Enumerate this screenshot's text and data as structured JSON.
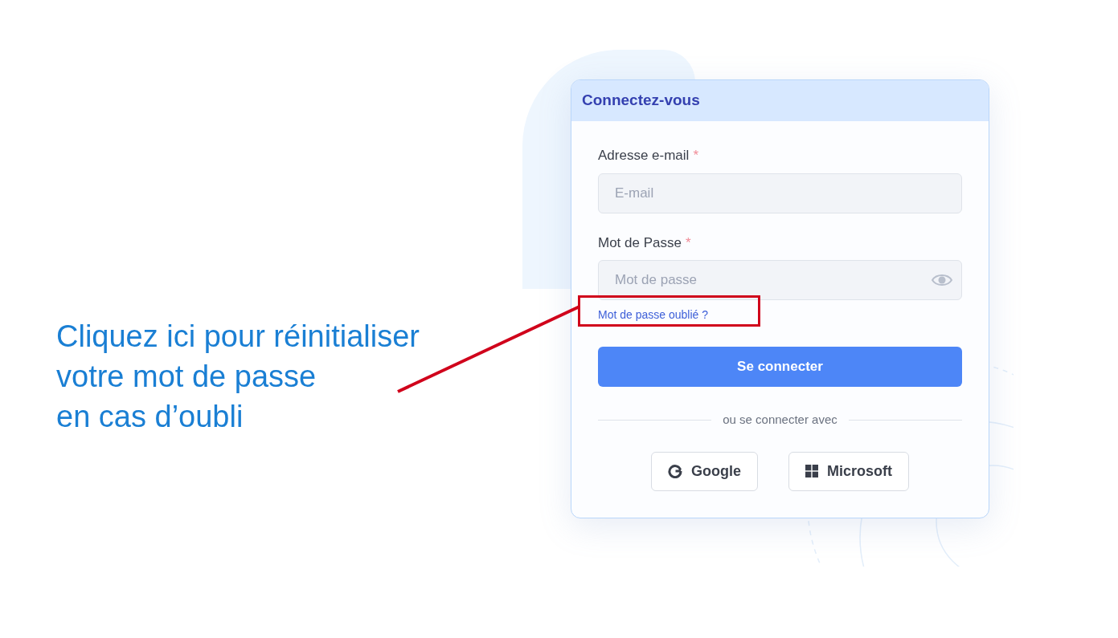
{
  "annotation": {
    "lines": [
      "Cliquez ici pour réinitialiser",
      "votre mot de passe",
      "en cas d’oubli"
    ]
  },
  "login_card": {
    "title": "Connectez-vous",
    "fields": [
      {
        "kind": "email",
        "label": "Adresse e-mail",
        "required_mark": "*",
        "placeholder": "E-mail"
      },
      {
        "kind": "password",
        "label": "Mot de Passe",
        "required_mark": "*",
        "placeholder": "Mot de passe"
      }
    ],
    "forgot_link": {
      "label": "Mot de passe oublié ?",
      "highlighted": true
    },
    "submit_button": "Se connecter",
    "divider_text": "ou se connecter avec",
    "social_buttons": [
      {
        "kind": "google",
        "label": "Google"
      },
      {
        "kind": "microsoft",
        "label": "Microsoft"
      }
    ]
  }
}
